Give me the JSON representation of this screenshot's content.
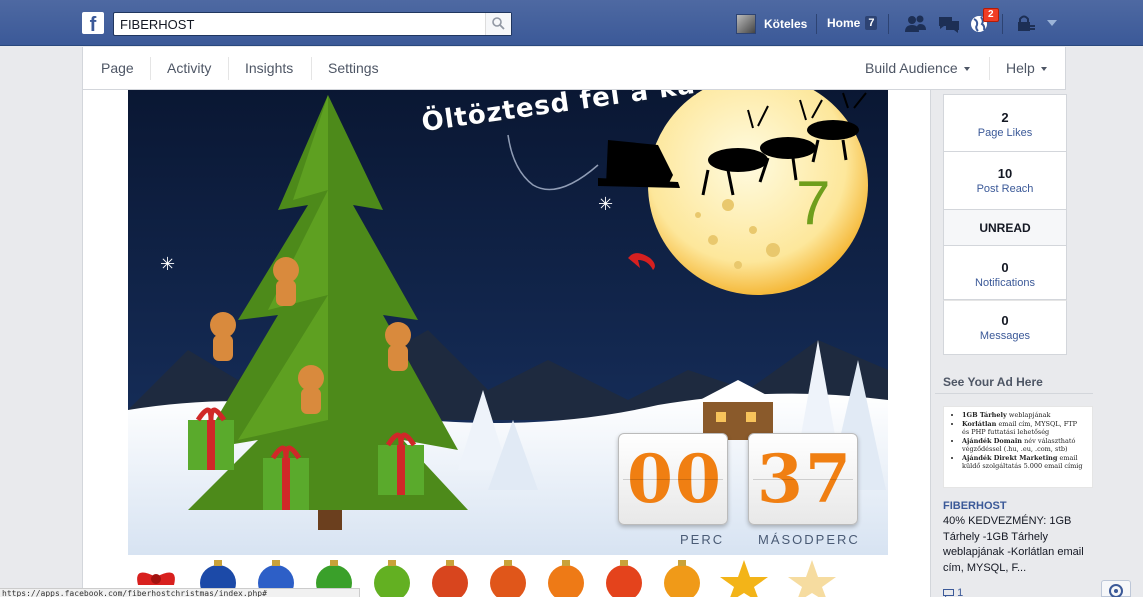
{
  "header": {
    "search_value": "FIBERHOST",
    "profile_name": "Köteles",
    "home_label": "Home",
    "home_count": "7",
    "notification_count": "2"
  },
  "page_nav": {
    "page": "Page",
    "activity": "Activity",
    "insights": "Insights",
    "settings": "Settings",
    "build_audience": "Build Audience",
    "help": "Help"
  },
  "app": {
    "title": "Öltöztesd fel a ka",
    "moon_number": "7",
    "timer": {
      "minutes": [
        "0",
        "0"
      ],
      "seconds": [
        "3",
        "7"
      ],
      "minutes_label": "PERC",
      "seconds_label": "MÁSODPERC"
    }
  },
  "sidebar": {
    "page_likes": {
      "value": "2",
      "label": "Page Likes"
    },
    "post_reach": {
      "value": "10",
      "label": "Post Reach"
    },
    "unread_header": "UNREAD",
    "notifications": {
      "value": "0",
      "label": "Notifications"
    },
    "messages": {
      "value": "0",
      "label": "Messages"
    },
    "ad_header": "See Your Ad Here",
    "ad_image": {
      "line1_bold": "1GB Tárhely",
      "line1_rest": "weblapjának",
      "line2_bold": "Korlátlan",
      "line2_rest": "email cím, MYSQL, FTP és PHP futtatási lehetőség",
      "line3_bold": "Ajándék Domain",
      "line3_rest": "név választható végződéssel (.hu, .eu, .com, stb)",
      "line4_bold": "Ajándék Direkt Marketing",
      "line4_rest": "email küldő szolgáltatás 5.000 email címig"
    },
    "ad_title": "FIBERHOST",
    "ad_body": "40% KEDVEZMÉNY: 1GB Tárhely -1GB Tárhely weblapjának -Korlátlan email cím, MYSQL, F...",
    "ad_likes": "1"
  },
  "status_url": "https://apps.facebook.com/fiberhostchristmas/index.php#"
}
